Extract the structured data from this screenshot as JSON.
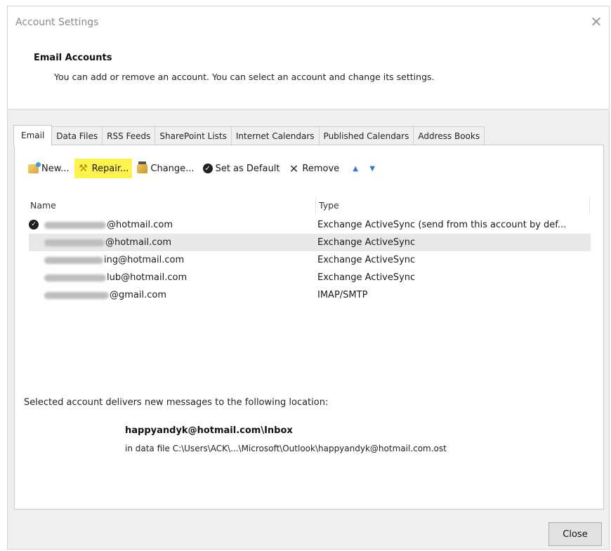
{
  "window": {
    "title": "Account Settings",
    "close_icon": "close-icon"
  },
  "header": {
    "title": "Email Accounts",
    "description": "You can add or remove an account. You can select an account and change its settings."
  },
  "tabs": [
    {
      "label": "Email",
      "active": true
    },
    {
      "label": "Data Files"
    },
    {
      "label": "RSS Feeds"
    },
    {
      "label": "SharePoint Lists"
    },
    {
      "label": "Internet Calendars"
    },
    {
      "label": "Published Calendars"
    },
    {
      "label": "Address Books"
    }
  ],
  "toolbar": {
    "new_label": "New...",
    "repair_label": "Repair...",
    "change_label": "Change...",
    "set_default_label": "Set as Default",
    "remove_label": "Remove",
    "highlight_color": "#fff34d"
  },
  "table": {
    "columns": [
      "Name",
      "Type"
    ],
    "rows": [
      {
        "name_visible": "@hotmail.com",
        "type": "Exchange ActiveSync (send from this account by def...",
        "default": true,
        "selected": false
      },
      {
        "name_visible": "@hotmail.com",
        "type": "Exchange ActiveSync",
        "default": false,
        "selected": true
      },
      {
        "name_visible": "ing@hotmail.com",
        "type": "Exchange ActiveSync",
        "default": false,
        "selected": false
      },
      {
        "name_visible": "lub@hotmail.com",
        "type": "Exchange ActiveSync",
        "default": false,
        "selected": false
      },
      {
        "name_visible": "@gmail.com",
        "type": "IMAP/SMTP",
        "default": false,
        "selected": false
      }
    ]
  },
  "location": {
    "label": "Selected account delivers new messages to the following location:",
    "path": "happyandyk@hotmail.com\\Inbox",
    "file": "in data file C:\\Users\\ACK\\...\\Microsoft\\Outlook\\happyandyk@hotmail.com.ost"
  },
  "footer": {
    "close_label": "Close"
  }
}
